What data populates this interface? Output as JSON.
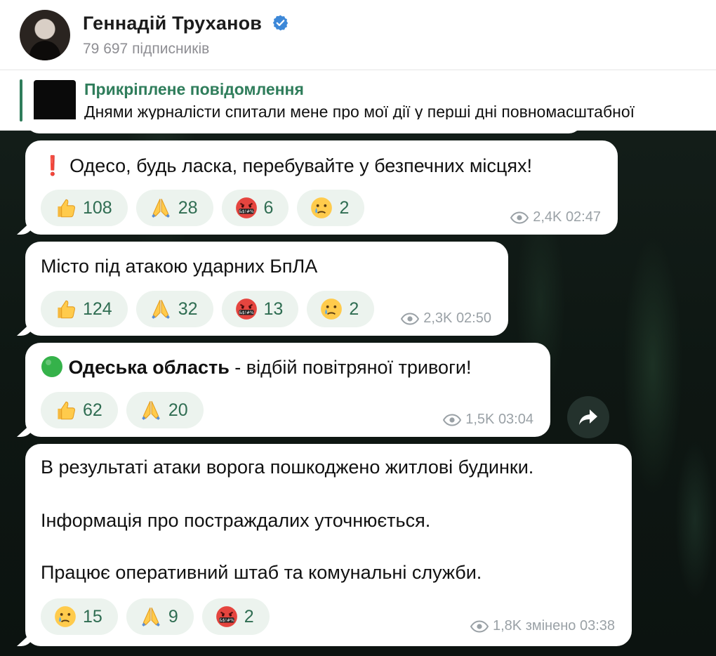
{
  "header": {
    "channel_name": "Геннадій Труханов",
    "subscribers": "79 697 підписників"
  },
  "pinned": {
    "title": "Прикріплене повідомлення",
    "text": "Днями журналісти спитали мене про мої дії у перші дні повномасштабної"
  },
  "messages": [
    {
      "text": "Одесо, будь ласка, перебувайте у безпечних місцях!",
      "reactions": [
        {
          "icon": "thumbs-up-icon",
          "count": "108"
        },
        {
          "icon": "praying-hands-icon",
          "count": "28"
        },
        {
          "icon": "swearing-face-icon",
          "count": "6"
        },
        {
          "icon": "crying-face-icon",
          "count": "2"
        }
      ],
      "views": "2,4K",
      "time": "02:47"
    },
    {
      "text": "Місто під атакою ударних БпЛА",
      "reactions": [
        {
          "icon": "thumbs-up-icon",
          "count": "124"
        },
        {
          "icon": "praying-hands-icon",
          "count": "32"
        },
        {
          "icon": "swearing-face-icon",
          "count": "13"
        },
        {
          "icon": "crying-face-icon",
          "count": "2"
        }
      ],
      "views": "2,3K",
      "time": "02:50"
    },
    {
      "text_bold": "Одеська область",
      "text_rest": " - відбій повітряної тривоги!",
      "reactions": [
        {
          "icon": "thumbs-up-icon",
          "count": "62"
        },
        {
          "icon": "praying-hands-icon",
          "count": "20"
        }
      ],
      "views": "1,5K",
      "time": "03:04"
    },
    {
      "line1": "В результаті атаки ворога пошкоджено житлові будинки.",
      "line2": "Інформація про постраждалих уточнюється.",
      "line3": "Працює оперативний штаб та комунальні служби.",
      "reactions": [
        {
          "icon": "crying-face-icon",
          "count": "15"
        },
        {
          "icon": "praying-hands-icon",
          "count": "9"
        },
        {
          "icon": "swearing-face-icon",
          "count": "2"
        }
      ],
      "views": "1,8K",
      "time": "змінено 03:38"
    }
  ],
  "colors": {
    "accent": "#2f7d5b",
    "reaction_bg": "#ecf3ee",
    "meta": "#9aa1a6"
  }
}
